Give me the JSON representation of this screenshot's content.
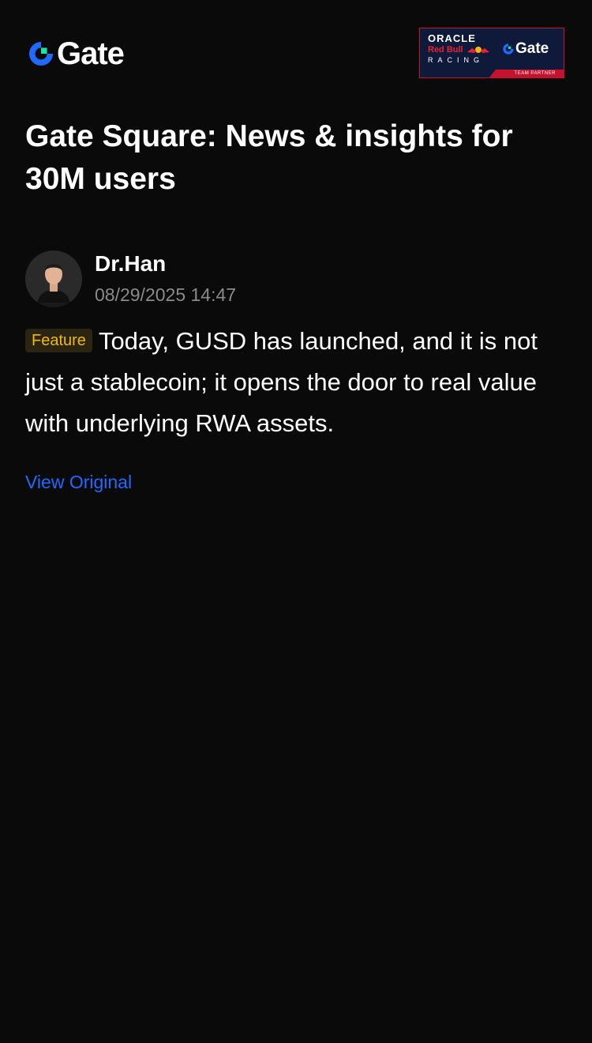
{
  "header": {
    "logo_text": "Gate",
    "partner_banner": {
      "oracle_text": "ORACLE",
      "redbull_text": "Red Bull",
      "racing_text": "RACING",
      "gate_text": "Gate",
      "partner_text": "TEAM PARTNER"
    }
  },
  "headline": "Gate Square: News & insights for 30M users",
  "post": {
    "author_name": "Dr.Han",
    "timestamp": "08/29/2025 14:47",
    "tag": "Feature",
    "body": "Today, GUSD has launched, and it is not just a stablecoin; it opens the door to real value with underlying RWA assets.",
    "view_original_label": "View Original"
  },
  "colors": {
    "background": "#0a0a0a",
    "brand_blue": "#1f6bff",
    "brand_green": "#17e6a1",
    "tag_text": "#f0b90b",
    "tag_bg": "#2b2410",
    "muted_text": "#8a8a8a",
    "banner_red": "#c4122f",
    "banner_navy": "#0f1a3a"
  }
}
